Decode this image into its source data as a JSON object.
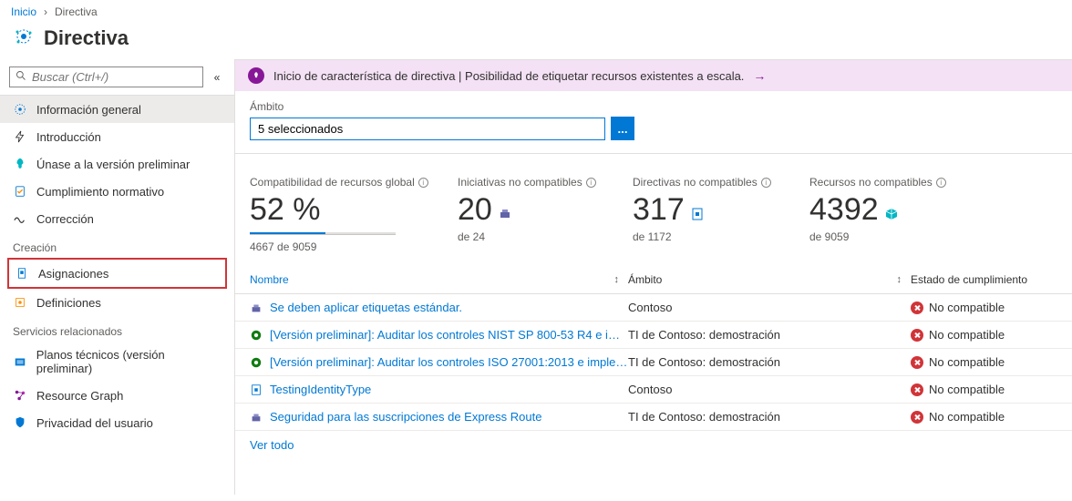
{
  "breadcrumb": {
    "home": "Inicio",
    "current": "Directiva"
  },
  "page_title": "Directiva",
  "search_placeholder": "Buscar (Ctrl+/)",
  "sidebar": {
    "items_top": [
      {
        "label": "Información general"
      },
      {
        "label": "Introducción"
      },
      {
        "label": "Únase a la versión preliminar"
      },
      {
        "label": "Cumplimiento normativo"
      },
      {
        "label": "Corrección"
      }
    ],
    "section_creation": "Creación",
    "items_creation": [
      {
        "label": "Asignaciones"
      },
      {
        "label": "Definiciones"
      }
    ],
    "section_related": "Servicios relacionados",
    "items_related": [
      {
        "label": "Planos técnicos (versión preliminar)"
      },
      {
        "label": "Resource Graph"
      },
      {
        "label": "Privacidad del usuario"
      }
    ]
  },
  "banner": {
    "text": "Inicio de característica de directiva | Posibilidad de etiquetar recursos existentes a escala."
  },
  "scope": {
    "label": "Ámbito",
    "value": "5 seleccionados"
  },
  "stats": {
    "compatibility": {
      "title": "Compatibilidad de recursos global",
      "value": "52 %",
      "sub": "4667 de 9059",
      "pct": 52
    },
    "initiatives": {
      "title": "Iniciativas no compatibles",
      "value": "20",
      "sub": "de 24"
    },
    "policies": {
      "title": "Directivas no compatibles",
      "value": "317",
      "sub": "de 1172"
    },
    "resources": {
      "title": "Recursos no compatibles",
      "value": "4392",
      "sub": "de 9059"
    }
  },
  "table": {
    "columns": {
      "name": "Nombre",
      "scope": "Ámbito",
      "state": "Estado de cumplimiento"
    },
    "see_all": "Ver todo",
    "rows": [
      {
        "name": "Se deben aplicar etiquetas estándar.",
        "scope": "Contoso",
        "state": "No compatible",
        "icon": "initiative"
      },
      {
        "name": "[Versión preliminar]: Auditar los controles NIST SP 800-53 R4 e impl...",
        "scope": "TI de Contoso: demostración",
        "state": "No compatible",
        "icon": "preview"
      },
      {
        "name": "[Versión preliminar]: Auditar los controles ISO 27001:2013 e implem...",
        "scope": "TI de Contoso: demostración",
        "state": "No compatible",
        "icon": "preview"
      },
      {
        "name": "TestingIdentityType",
        "scope": "Contoso",
        "state": "No compatible",
        "icon": "policy"
      },
      {
        "name": "Seguridad para las suscripciones de Express Route",
        "scope": "TI de Contoso: demostración",
        "state": "No compatible",
        "icon": "initiative"
      }
    ]
  }
}
